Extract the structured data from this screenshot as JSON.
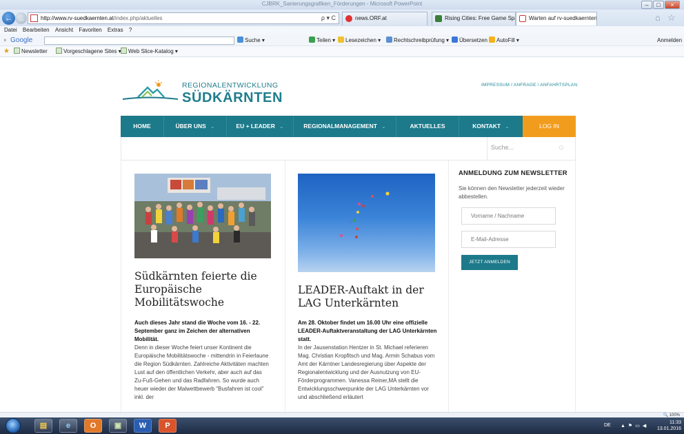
{
  "browser": {
    "window_title": "CJBRK_Sanierungsgrafiken_Förderungen - Microsoft PowerPoint",
    "address_url_host": "http://www.rv-suedkaernten.at",
    "address_url_path": "/index.php/aktuelles",
    "address_controls": "ρ ▾ C",
    "tabs": [
      {
        "label": "news.ORF.at"
      },
      {
        "label": "Rising Cities: Free Game Spaß f..."
      },
      {
        "label": "Warten auf rv-suedkaernten... ×"
      }
    ],
    "menu": [
      "Datei",
      "Bearbeiten",
      "Ansicht",
      "Favoriten",
      "Extras",
      "?"
    ],
    "google_toolbar": {
      "close": "×",
      "logo": "Google",
      "items": [
        "Suche ▾",
        "Teilen ▾",
        "Lesezeichen ▾",
        "Rechtschreibprüfung ▾",
        "Übersetzen ▾",
        "AutoFill ▾"
      ],
      "signin": "Anmelden"
    },
    "favorites": [
      "Newsletter",
      "Vorgeschlagene Sites ▾",
      "Web Slice-Katalog ▾"
    ],
    "status_zoom": "100%"
  },
  "site": {
    "logo_line1": "REGIONALENTWICKLUNG",
    "logo_line2": "SÜDKÄRNTEN",
    "top_links": "IMPRESSUM / ANFRAGE / ANFAHRTSPLAN",
    "nav": [
      {
        "label": "HOME"
      },
      {
        "label": "ÜBER UNS"
      },
      {
        "label": "EU + LEADER"
      },
      {
        "label": "REGIONALMANAGEMENT"
      },
      {
        "label": "AKTUELLES"
      },
      {
        "label": "KONTAKT"
      }
    ],
    "nav_chevron": "⌄",
    "login": "LOG IN",
    "search_placeholder": "Suche...",
    "articles": [
      {
        "title": "Südkärnten feierte die Europäische Mobilitätswoche",
        "lead": "Auch dieses Jahr stand die Woche vom 16. - 22. September ganz im Zeichen der alternativen Mobilität.",
        "body": "Denn in dieser Woche feiert unser Kontinent die Europäische Mobilitätswoche - mittendrin in Feierlaune die Region Südkärnten. Zahlreiche Aktivitäten machten Lust auf den öffentlichen Verkehr, aber auch auf das Zu-Fuß-Gehen und das Radfahren. So wurde auch heuer wieder der Malwettbewerb \"Busfahren ist cool\" inkl. der"
      },
      {
        "title": "LEADER-Auftakt in der LAG Unterkärnten",
        "lead": "Am 28. Oktober findet um 16.00 Uhr eine offizielle LEADER-Auftaktveranstaltung der LAG Unterkärnten statt.",
        "body": "In der Jausenstation Hentzer in St. Michael referieren Mag. Christian Kropfitsch und Mag. Armin Schabus vom Amt der Kärntner Landesregierung über Aspekte der Regionalentwicklung und der Ausnutzung von EU-Förderprogrammen. Vanessa Reiner,MA stellt die Entwicklungsschwerpunkte der LAG Unterkärnten vor und abschließend erläutert"
      }
    ],
    "newsletter": {
      "title": "ANMELDUNG ZUM NEWSLETTER",
      "text": "Sie können den Newsletter jederzeit wieder abbestellen.",
      "name_placeholder": "Vorname / Nachname",
      "email_placeholder": "E-Mail-Adresse",
      "button": "JETZT ANMELDEN"
    }
  },
  "taskbar": {
    "language": "DE",
    "time": "11:33",
    "date": "13.01.2016"
  },
  "colors": {
    "brand_teal": "#1c7a8a",
    "login_orange": "#f29c1e"
  }
}
